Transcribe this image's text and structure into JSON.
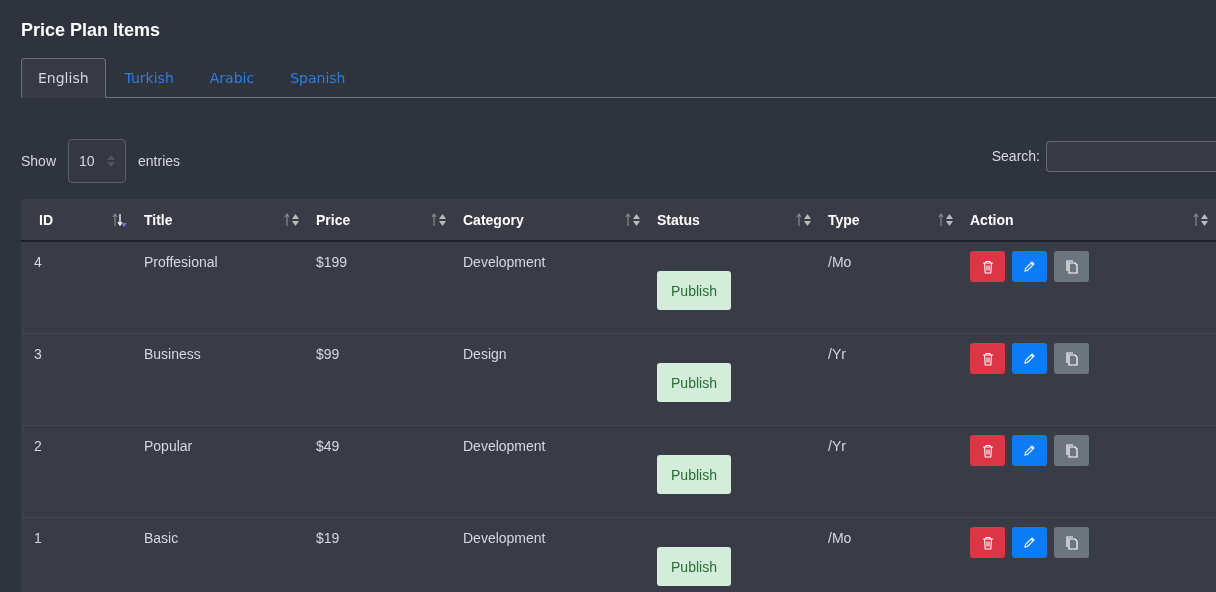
{
  "title": "Price Plan Items",
  "tabs": [
    {
      "label": "English",
      "selected": true
    },
    {
      "label": "Turkish",
      "selected": false
    },
    {
      "label": "Arabic",
      "selected": false
    },
    {
      "label": "Spanish",
      "selected": false
    }
  ],
  "length": {
    "label_before": "Show",
    "value": "10",
    "label_after": "entries"
  },
  "search": {
    "label": "Search:"
  },
  "table": {
    "columns": [
      {
        "label": "ID",
        "sorted": true
      },
      {
        "label": "Title",
        "sorted": false
      },
      {
        "label": "Price",
        "sorted": false
      },
      {
        "label": "Category",
        "sorted": false
      },
      {
        "label": "Status",
        "sorted": false
      },
      {
        "label": "Type",
        "sorted": false
      },
      {
        "label": "Action",
        "sorted": false
      }
    ],
    "rows": [
      {
        "id": "4",
        "title": "Proffesional",
        "price": "$199",
        "category": "Development",
        "status": "Publish",
        "type": "/Mo"
      },
      {
        "id": "3",
        "title": "Business",
        "price": "$99",
        "category": "Design",
        "status": "Publish",
        "type": "/Yr"
      },
      {
        "id": "2",
        "title": "Popular",
        "price": "$49",
        "category": "Development",
        "status": "Publish",
        "type": "/Yr"
      },
      {
        "id": "1",
        "title": "Basic",
        "price": "$19",
        "category": "Development",
        "status": "Publish",
        "type": "/Mo"
      }
    ]
  }
}
